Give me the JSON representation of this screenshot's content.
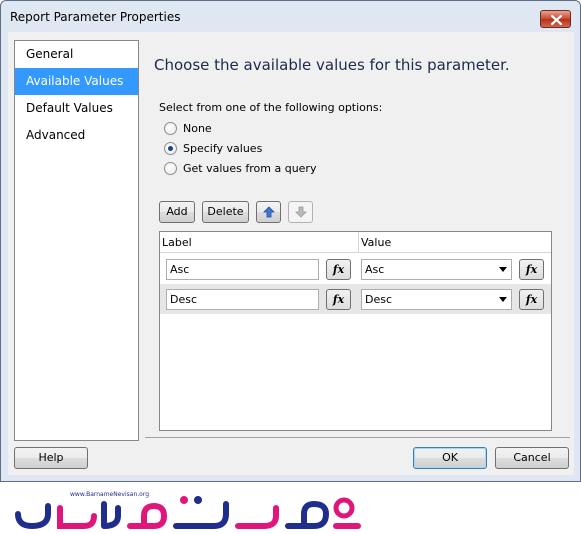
{
  "window": {
    "title": "Report Parameter Properties"
  },
  "nav": {
    "items": [
      {
        "label": "General",
        "selected": false
      },
      {
        "label": "Available Values",
        "selected": true
      },
      {
        "label": "Default Values",
        "selected": false
      },
      {
        "label": "Advanced",
        "selected": false
      }
    ]
  },
  "main": {
    "heading": "Choose the available values for this parameter.",
    "options_label": "Select from one of the following options:",
    "options": [
      {
        "label": "None",
        "checked": false
      },
      {
        "label": "Specify values",
        "checked": true
      },
      {
        "label": "Get values from a query",
        "checked": false
      }
    ]
  },
  "toolbar": {
    "add_label": "Add",
    "delete_label": "Delete",
    "move_up_icon": "arrow-up-icon",
    "move_down_icon": "arrow-down-icon"
  },
  "grid": {
    "columns": [
      "Label",
      "Value"
    ],
    "rows": [
      {
        "label": "Asc",
        "fx": "fx",
        "value": "Asc"
      },
      {
        "label": "Desc",
        "fx": "fx",
        "value": "Desc"
      }
    ]
  },
  "footer": {
    "help_label": "Help",
    "ok_label": "OK",
    "cancel_label": "Cancel"
  },
  "watermark": {
    "url_text": "www.BarnameNevisan.org",
    "brand_text": "برنامه نویسان",
    "colors": [
      "#1f2d8c",
      "#e0177a"
    ]
  },
  "colors": {
    "selection": "#3399ff",
    "window_frame": "#dfe7f2",
    "close_button": "#c9452e"
  }
}
